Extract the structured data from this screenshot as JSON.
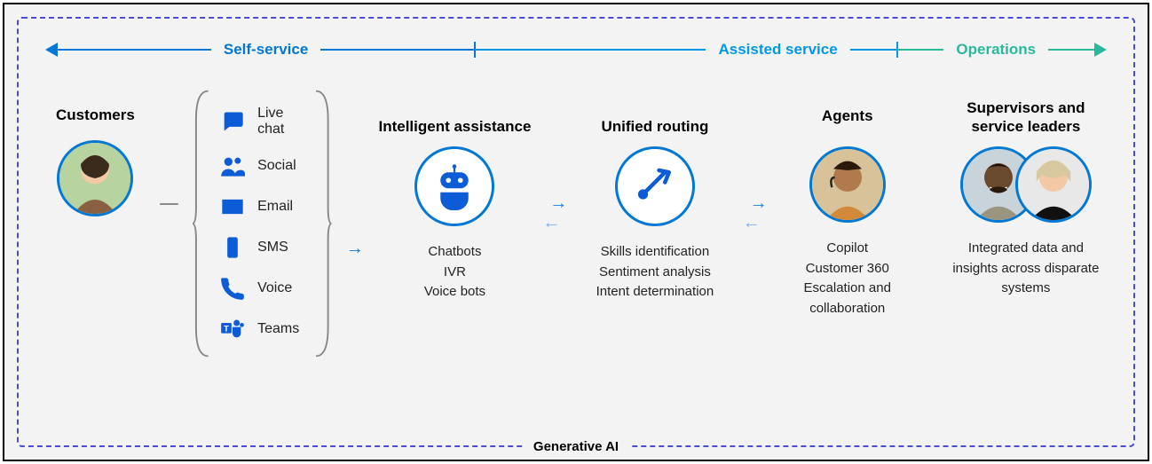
{
  "categories": {
    "self_service": "Self-service",
    "assisted_service": "Assisted service",
    "operations": "Operations"
  },
  "customers": {
    "title": "Customers"
  },
  "channels": [
    {
      "icon": "chat",
      "label": "Live chat"
    },
    {
      "icon": "social",
      "label": "Social"
    },
    {
      "icon": "email",
      "label": "Email"
    },
    {
      "icon": "sms",
      "label": "SMS"
    },
    {
      "icon": "voice",
      "label": "Voice"
    },
    {
      "icon": "teams",
      "label": "Teams"
    }
  ],
  "intelligent": {
    "title": "Intelligent assistance",
    "lines": [
      "Chatbots",
      "IVR",
      "Voice bots"
    ]
  },
  "routing": {
    "title": "Unified routing",
    "lines": [
      "Skills identification",
      "Sentiment analysis",
      "Intent determination"
    ]
  },
  "agents": {
    "title": "Agents",
    "lines": [
      "Copilot",
      "Customer 360",
      "Escalation and collaboration"
    ]
  },
  "supervisors": {
    "title": "Supervisors and service leaders",
    "lines": [
      "Integrated data and insights across disparate systems"
    ]
  },
  "footer": "Generative AI"
}
